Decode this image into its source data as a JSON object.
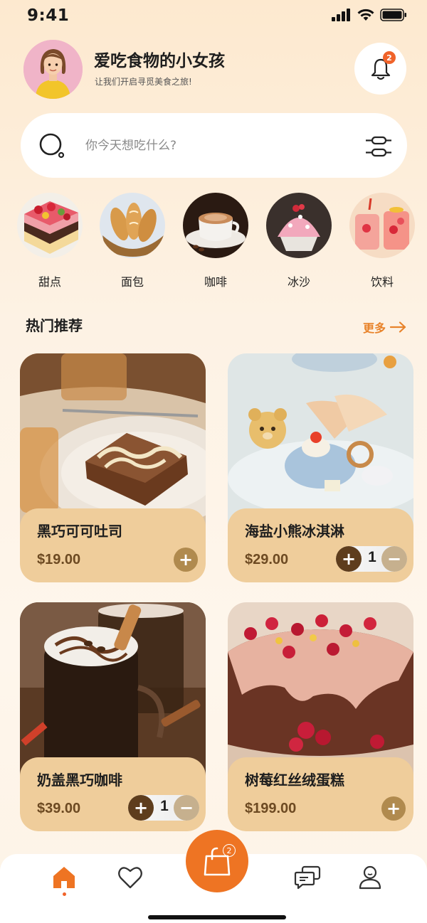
{
  "status_bar": {
    "time": "9:41"
  },
  "header": {
    "user_name": "爱吃食物的小女孩",
    "subtitle": "让我们开启寻觅美食之旅!",
    "notification_count": "2"
  },
  "search": {
    "placeholder": "你今天想吃什么?"
  },
  "categories": [
    {
      "label": "甜点",
      "icon": "cake-image"
    },
    {
      "label": "面包",
      "icon": "bread-image"
    },
    {
      "label": "咖啡",
      "icon": "coffee-image"
    },
    {
      "label": "冰沙",
      "icon": "shaved-ice-image"
    },
    {
      "label": "饮料",
      "icon": "drink-image"
    }
  ],
  "section": {
    "title": "热门推荐",
    "more_label": "更多"
  },
  "products": [
    {
      "name": "黑巧可可吐司",
      "price": "$19.00",
      "control": "add"
    },
    {
      "name": "海盐小熊冰淇淋",
      "price": "$29.00",
      "control": "stepper",
      "quantity": "1"
    },
    {
      "name": "奶盖黑巧咖啡",
      "price": "$39.00",
      "control": "stepper",
      "quantity": "1"
    },
    {
      "name": "树莓红丝绒蛋糕",
      "price": "$199.00",
      "control": "add"
    }
  ],
  "bottom_nav": {
    "items": [
      "home-icon",
      "heart-icon",
      "chat-icon",
      "profile-icon"
    ],
    "cart_count": "2",
    "active": "home"
  },
  "colors": {
    "accent": "#ee7423",
    "card_panel": "#efcd9b",
    "price": "#6d4a22",
    "badge": "#f0632a"
  }
}
